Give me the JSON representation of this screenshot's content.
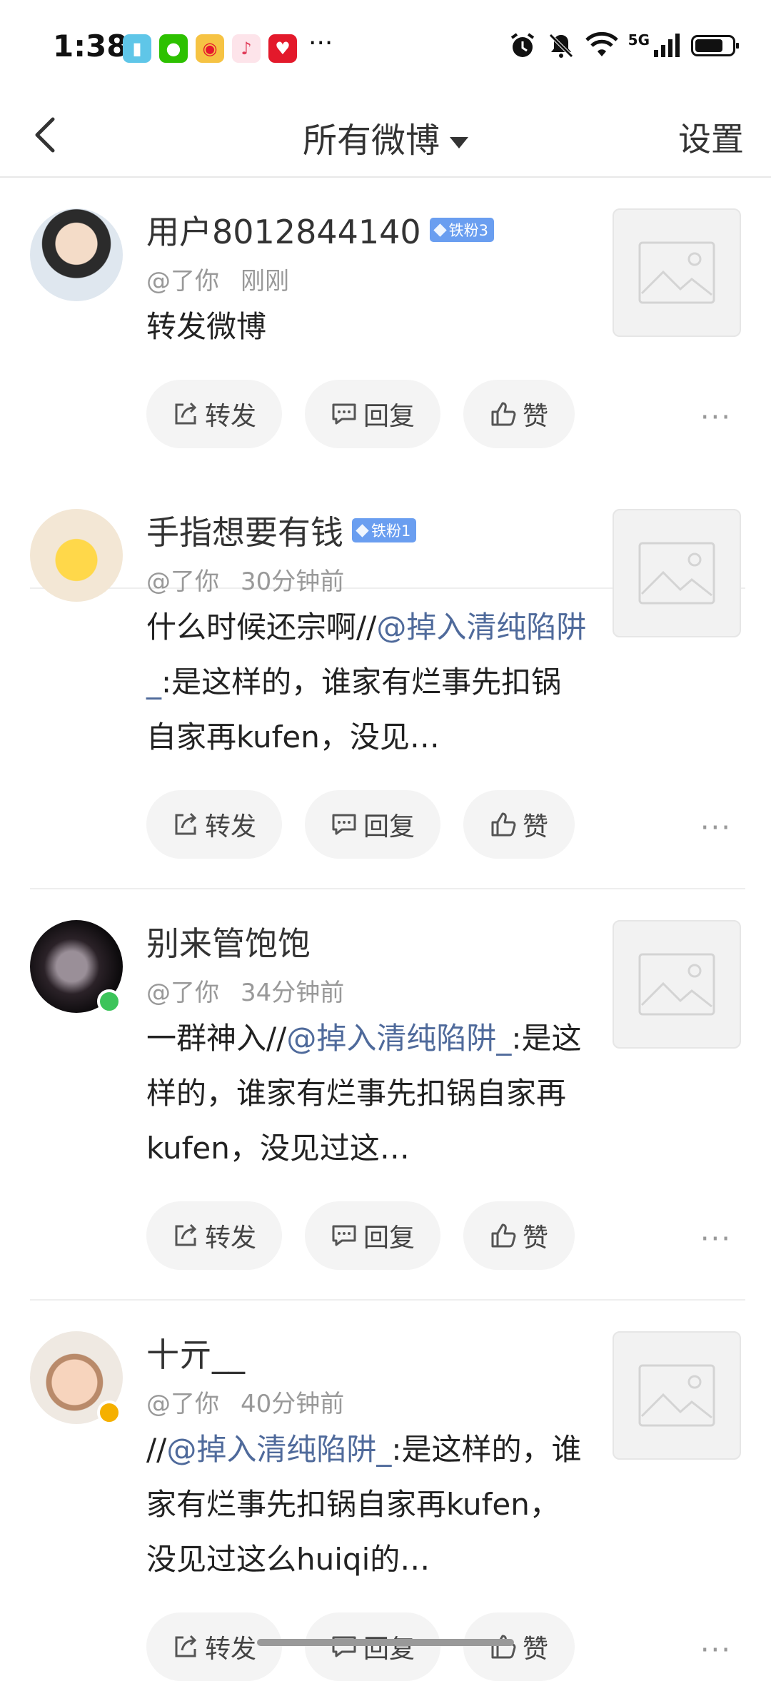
{
  "status_bar": {
    "time": "1:38",
    "more": "···",
    "network": "5G",
    "icons": [
      "book-app-icon",
      "wechat-icon",
      "weibo-icon",
      "music-icon",
      "heart-app-icon",
      "alarm-icon",
      "mute-icon",
      "wifi-icon",
      "signal-icon",
      "battery-icon"
    ]
  },
  "nav": {
    "title": "所有微博",
    "settings": "设置"
  },
  "actions": {
    "repost": "转发",
    "reply": "回复",
    "like": "赞",
    "more": "···"
  },
  "items": [
    {
      "username": "用户8012844140",
      "fan_badge": "铁粉3",
      "mention": "@了你",
      "time": "刚刚",
      "content": [
        {
          "text": "转发微博",
          "mention": false
        }
      ]
    },
    {
      "username": "手指想要有钱",
      "fan_badge": "铁粉1",
      "mention": "@了你",
      "time": "30分钟前",
      "content": [
        {
          "text": "什么时候还宗啊//",
          "mention": false
        },
        {
          "text": "@掉入清纯陷阱_",
          "mention": true
        },
        {
          "text": ":是这样的，谁家有烂事先扣锅自家再kufen，没见…",
          "mention": false
        }
      ]
    },
    {
      "username": "别来管饱饱",
      "fan_badge": "",
      "mention": "@了你",
      "time": "34分钟前",
      "content": [
        {
          "text": "一群神入//",
          "mention": false
        },
        {
          "text": "@掉入清纯陷阱_",
          "mention": true
        },
        {
          "text": ":是这样的，谁家有烂事先扣锅自家再kufen，没见过这…",
          "mention": false
        }
      ]
    },
    {
      "username": "十亓__",
      "fan_badge": "",
      "mention": "@了你",
      "time": "40分钟前",
      "content": [
        {
          "text": "//",
          "mention": false
        },
        {
          "text": "@掉入清纯陷阱_",
          "mention": true
        },
        {
          "text": ":是这样的，谁家有烂事先扣锅自家再kufen，没见过这么huiqi的…",
          "mention": false
        }
      ]
    }
  ],
  "colors": {
    "mention": "#4f6a9b",
    "fan_badge": "#6a9ef0",
    "online_dot": "#3cc45a",
    "verified": "#f5b000"
  }
}
